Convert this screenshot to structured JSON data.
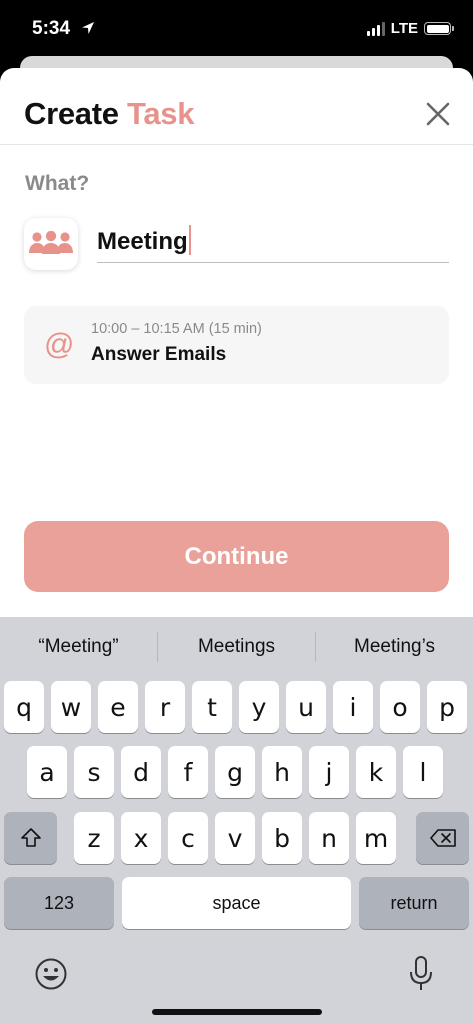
{
  "status_bar": {
    "time": "5:34",
    "network": "LTE"
  },
  "header": {
    "title_main": "Create",
    "title_accent": "Task"
  },
  "form": {
    "what_label": "What?",
    "task_value": "Meeting",
    "icon": "people-group-icon"
  },
  "suggestion": {
    "icon": "at-icon",
    "time": "10:00 – 10:15 AM (15 min)",
    "title": "Answer Emails"
  },
  "continue_label": "Continue",
  "keyboard": {
    "predictions": [
      "“Meeting”",
      "Meetings",
      "Meeting’s"
    ],
    "row1": [
      "q",
      "w",
      "e",
      "r",
      "t",
      "y",
      "u",
      "i",
      "o",
      "p"
    ],
    "row2": [
      "a",
      "s",
      "d",
      "f",
      "g",
      "h",
      "j",
      "k",
      "l"
    ],
    "row3": [
      "z",
      "x",
      "c",
      "v",
      "b",
      "n",
      "m"
    ],
    "numbers_label": "123",
    "space_label": "space",
    "return_label": "return"
  },
  "colors": {
    "accent": "#e8928c",
    "button": "#e9a19a",
    "keyboard_bg": "#d1d3d9"
  }
}
